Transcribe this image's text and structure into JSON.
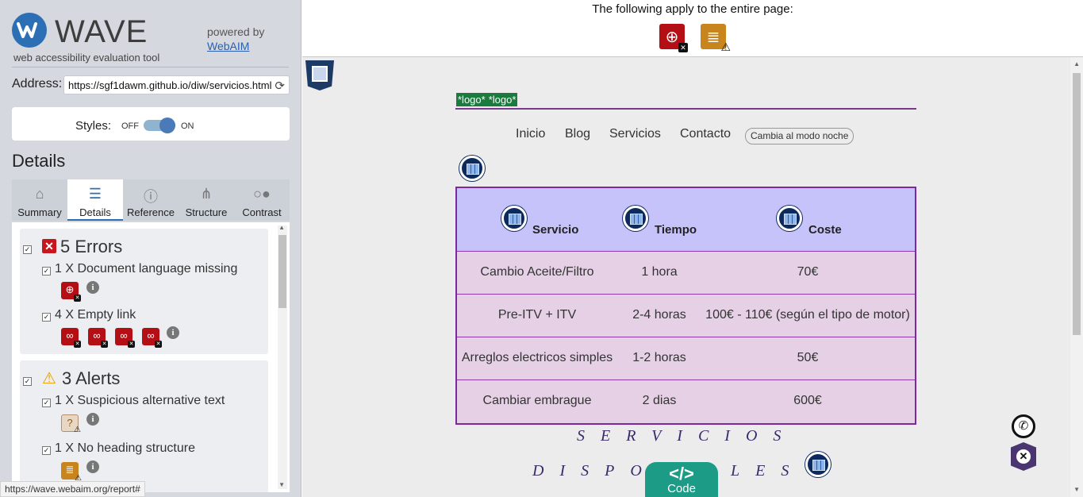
{
  "wave": {
    "logo_word": "WAVE",
    "logo_sub": "web accessibility evaluation tool",
    "powered_by": "powered by",
    "webaim_link": "WebAIM",
    "address_label": "Address:",
    "address_value": "https://sgf1dawm.github.io/diw/servicios.html",
    "styles_label": "Styles:",
    "styles_off": "OFF",
    "styles_on": "ON",
    "details_heading": "Details",
    "tabs": [
      {
        "label": "Summary",
        "icon": "home-icon"
      },
      {
        "label": "Details",
        "icon": "list-icon"
      },
      {
        "label": "Reference",
        "icon": "info-icon"
      },
      {
        "label": "Structure",
        "icon": "sitemap-icon"
      },
      {
        "label": "Contrast",
        "icon": "contrast-icon"
      }
    ],
    "errors": {
      "title": "5 Errors",
      "items": [
        {
          "label": "1 X Document language missing"
        },
        {
          "label": "4 X Empty link"
        }
      ]
    },
    "alerts": {
      "title": "3 Alerts",
      "items": [
        {
          "label": "1 X Suspicious alternative text"
        },
        {
          "label": "1 X No heading structure"
        }
      ]
    },
    "status_url": "https://wave.webaim.org/report#"
  },
  "page": {
    "entire_page_text": "The following apply to the entire page:",
    "logo_text": [
      "*logo*",
      "*logo*"
    ],
    "nav": [
      "Inicio",
      "Blog",
      "Servicios",
      "Contacto"
    ],
    "night_button": "Cambia al modo noche",
    "table": {
      "headers": [
        "Servicio",
        "Tiempo",
        "Coste"
      ],
      "rows": [
        [
          "Cambio Aceite/Filtro",
          "1 hora",
          "70€"
        ],
        [
          "Pre-ITV + ITV",
          "2-4 horas",
          "100€ - 110€ (según el tipo de motor)"
        ],
        [
          "Arreglos electricos simples",
          "1-2 horas",
          "50€"
        ],
        [
          "Cambiar embrague",
          "2 dias",
          "600€"
        ]
      ]
    },
    "deco_line1": "SERVICIOS",
    "deco_line2": "DISPONIBLES",
    "code_button": "Code"
  }
}
